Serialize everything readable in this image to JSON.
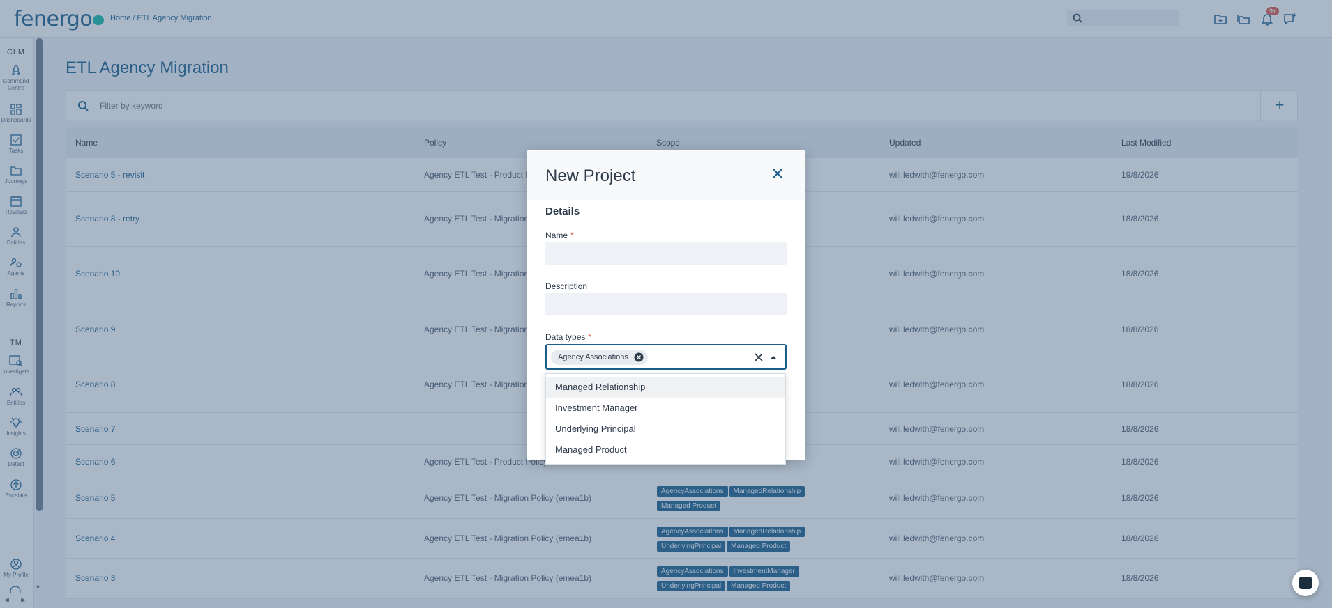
{
  "app": {
    "logo_text": "fenergo"
  },
  "breadcrumb": {
    "home": "Home",
    "separator": "/",
    "current": "ETL Agency Migration"
  },
  "topbar": {
    "notification_count": "9+"
  },
  "sidebar": {
    "clm_label": "CLM",
    "tm_label": "TM",
    "clm_items": [
      {
        "label": "Command Centre",
        "icon": "rocket-icon"
      },
      {
        "label": "Dashboards",
        "icon": "grid-icon"
      },
      {
        "label": "Tasks",
        "icon": "checkbox-icon"
      },
      {
        "label": "Journeys",
        "icon": "folder-icon"
      },
      {
        "label": "Reviews",
        "icon": "calendar-icon"
      },
      {
        "label": "Entities",
        "icon": "person-icon"
      },
      {
        "label": "Agents",
        "icon": "agents-icon"
      },
      {
        "label": "Reports",
        "icon": "bar-chart-icon"
      }
    ],
    "tm_items": [
      {
        "label": "Investigate",
        "icon": "investigate-icon"
      },
      {
        "label": "Entities",
        "icon": "people-icon"
      },
      {
        "label": "Insights",
        "icon": "lightbulb-icon"
      },
      {
        "label": "Detect",
        "icon": "target-icon"
      },
      {
        "label": "Escalate",
        "icon": "escalate-icon"
      }
    ],
    "profile_label": "My Profile"
  },
  "page": {
    "title": "ETL Agency Migration",
    "filter_placeholder": "Filter by keyword"
  },
  "table": {
    "columns": [
      "Name",
      "Policy",
      "Scope",
      "Updated",
      "Last Modified"
    ],
    "rows": [
      {
        "name": "Scenario 5 - revisit",
        "policy": "Agency ETL Test - Product P",
        "tags": [],
        "updated": "will.ledwith@fenergo.com",
        "modified": "19/8/2026"
      },
      {
        "name": "Scenario 8 - retry",
        "policy": "Agency ETL Test - Migration",
        "tags": [],
        "updated": "will.ledwith@fenergo.com",
        "modified": "18/8/2026"
      },
      {
        "name": "Scenario 10",
        "policy": "Agency ETL Test - Migration",
        "tags": [],
        "updated": "will.ledwith@fenergo.com",
        "modified": "18/8/2026"
      },
      {
        "name": "Scenario 9",
        "policy": "Agency ETL Test - Migration",
        "tags": [],
        "updated": "will.ledwith@fenergo.com",
        "modified": "18/8/2026"
      },
      {
        "name": "Scenario 8",
        "policy": "Agency ETL Test - Migration",
        "tags": [],
        "updated": "will.ledwith@fenergo.com",
        "modified": "18/8/2026"
      },
      {
        "name": "Scenario 7",
        "policy": "",
        "tags": [],
        "updated": "will.ledwith@fenergo.com",
        "modified": "18/8/2026"
      },
      {
        "name": "Scenario 6",
        "policy": "Agency ETL Test - Product Policy",
        "tags": [],
        "updated": "will.ledwith@fenergo.com",
        "modified": "18/8/2026"
      },
      {
        "name": "Scenario 5",
        "policy": "Agency ETL Test - Migration Policy (emea1b)",
        "tags": [
          "AgencyAssociations",
          "ManagedRelationship",
          "Managed Product"
        ],
        "updated": "will.ledwith@fenergo.com",
        "modified": "18/8/2026"
      },
      {
        "name": "Scenario 4",
        "policy": "Agency ETL Test - Migration Policy (emea1b)",
        "tags": [
          "AgencyAssociations",
          "ManagedRelationship",
          "UnderlyingPrincipal",
          "Managed Product"
        ],
        "updated": "will.ledwith@fenergo.com",
        "modified": "18/8/2026"
      },
      {
        "name": "Scenario 3",
        "policy": "Agency ETL Test - Migration Policy (emea1b)",
        "tags": [
          "AgencyAssociations",
          "InvestmentManager",
          "UnderlyingPrincipal",
          "Managed Product"
        ],
        "updated": "will.ledwith@fenergo.com",
        "modified": "18/8/2026"
      }
    ]
  },
  "modal": {
    "title": "New Project",
    "section": "Details",
    "name_label": "Name",
    "name_value": "",
    "description_label": "Description",
    "description_value": "",
    "data_types_label": "Data types",
    "required_mark": "*",
    "selected_chip": "Agency Associations",
    "dropdown_options": [
      "Managed Relationship",
      "Investment Manager",
      "Underlying Principal",
      "Managed Product"
    ]
  },
  "colors": {
    "brand": "#1c5f8c",
    "accent": "#17b8a6",
    "required": "#e0564a",
    "overlay": "#405f82"
  }
}
